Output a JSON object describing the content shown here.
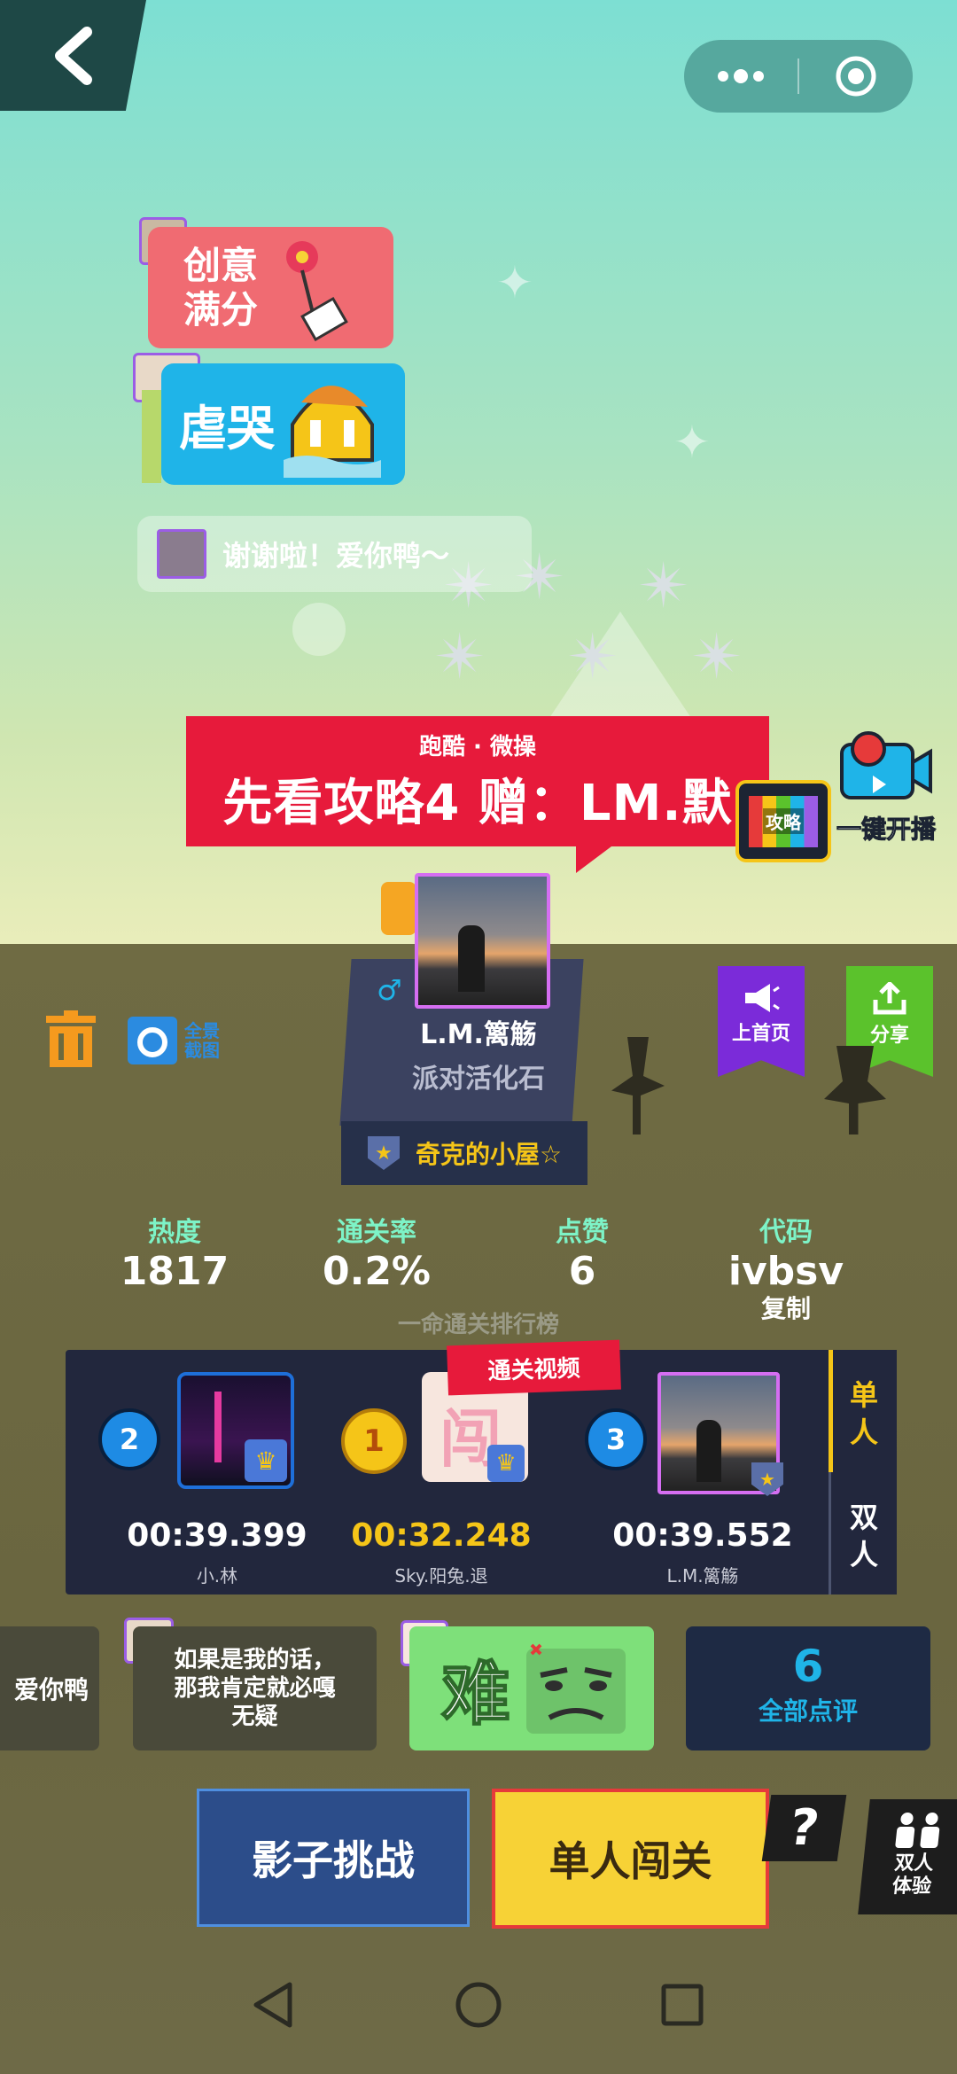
{
  "bubbles": {
    "creative": "创意\n满分",
    "sad": "虐哭",
    "thanks": "谢谢啦！爱你鸭～"
  },
  "banner": {
    "subtitle": "跑酷 · 微操",
    "title": "先看攻略4 赠：LM.默"
  },
  "side": {
    "guide_label": "攻略",
    "broadcast_label": "一键开播",
    "homepage_label": "上首页",
    "share_label": "分享",
    "panorama_label": "全景\n截图"
  },
  "profile": {
    "gender_symbol": "♂",
    "name": "L.M.篱觞",
    "title": "派对活化石",
    "club": "奇克的小屋☆"
  },
  "stats": [
    {
      "label": "热度",
      "value": "1817"
    },
    {
      "label": "通关率",
      "value": "0.2%"
    },
    {
      "label": "点赞",
      "value": "6"
    },
    {
      "label": "代码",
      "value": "ivbsv"
    }
  ],
  "copy_label": "复制",
  "leaderboard": {
    "title": "一命通关排行榜",
    "video_label": "通关视频",
    "entries": [
      {
        "rank": "2",
        "time": "00:39.399",
        "name": "小.林"
      },
      {
        "rank": "1",
        "time": "00:32.248",
        "name": "Sky.阳兔.退"
      },
      {
        "rank": "3",
        "time": "00:39.552",
        "name": "L.M.篱觞"
      }
    ],
    "tabs": [
      "单\n人",
      "双\n人"
    ]
  },
  "reviews": {
    "left_partial": "爱你鸭",
    "comment": "如果是我的话，\n那我肯定就必嘎\n无疑",
    "hard": "难",
    "count": "6",
    "all_label": "全部点评"
  },
  "actions": {
    "shadow": "影子挑战",
    "solo": "单人闯关",
    "help": "?",
    "duo": "双人\n体验"
  },
  "colors": {
    "banner_red": "#e71a3b",
    "purple_tab": "#7b2bd9",
    "green_tab": "#5bc22c",
    "solo_yellow": "#f7d236",
    "shadow_blue": "#2c4d8a",
    "accent_teal": "#7df3c7",
    "gold": "#f5c518"
  }
}
